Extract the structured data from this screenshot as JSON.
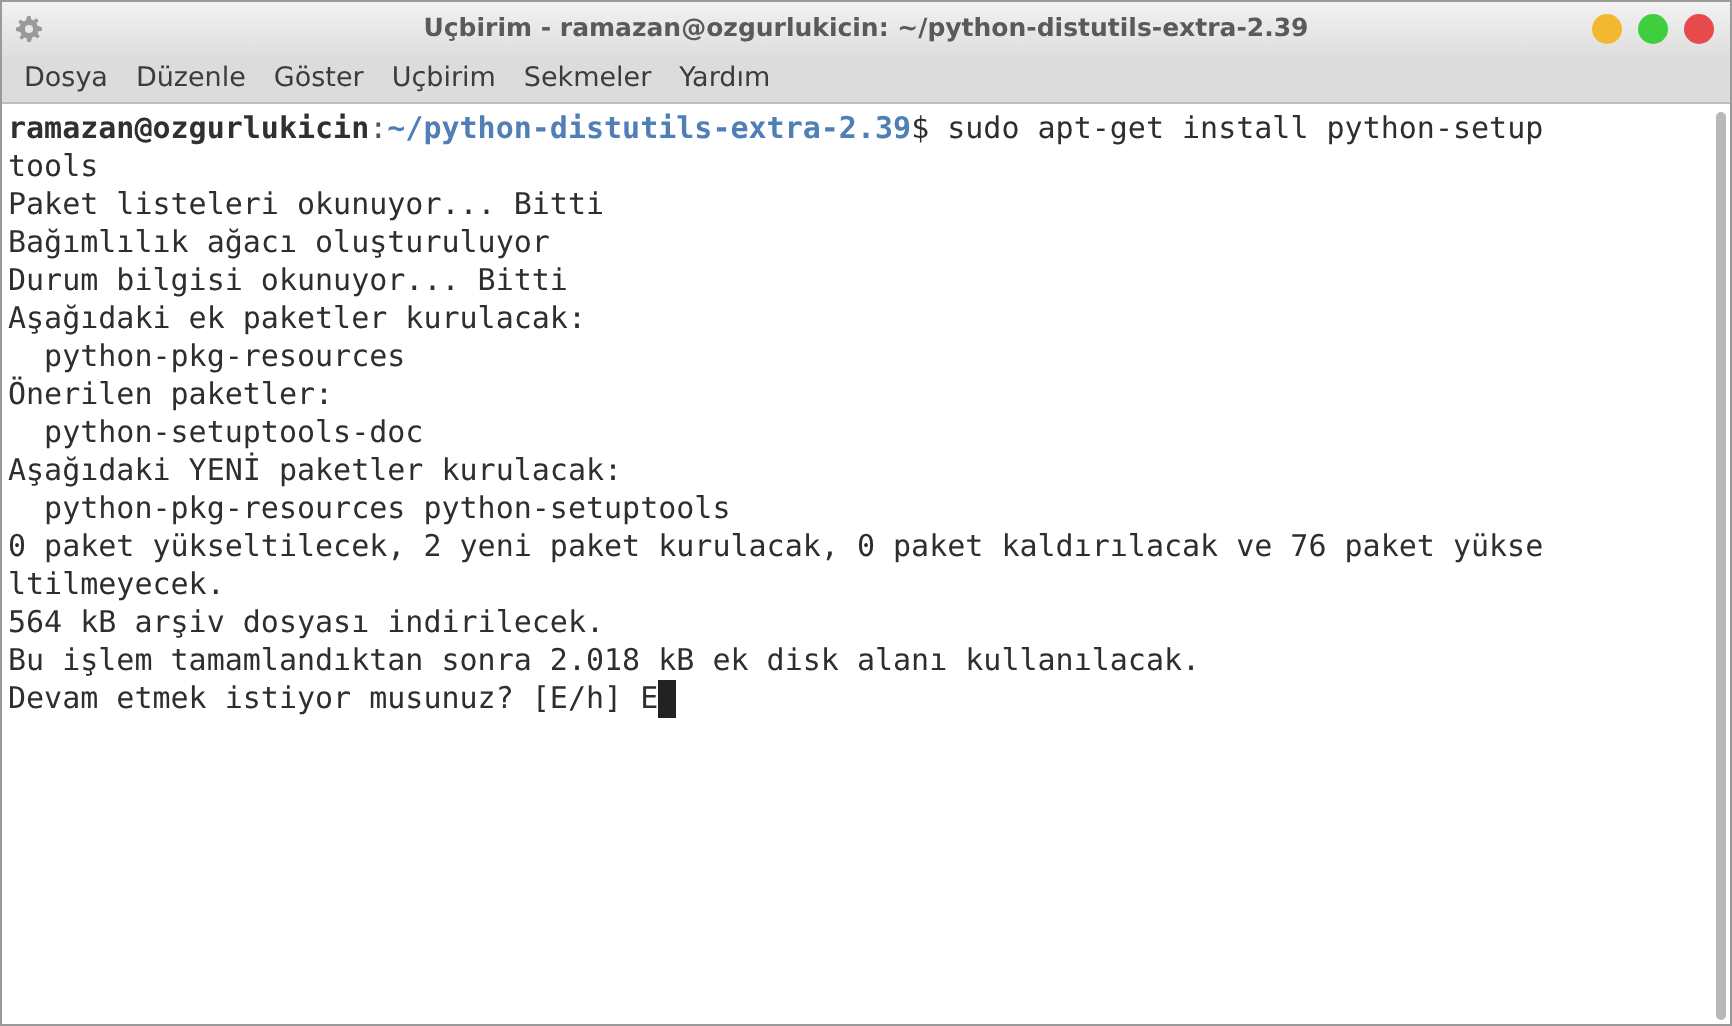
{
  "window": {
    "title": "Uçbirim - ramazan@ozgurlukicin: ~/python-distutils-extra-2.39"
  },
  "menu": [
    "Dosya",
    "Düzenle",
    "Göster",
    "Uçbirim",
    "Sekmeler",
    "Yardım"
  ],
  "terminal": {
    "prompt": {
      "user": "ramazan@ozgurlukicin",
      "separator": ":",
      "path": "~/python-distutils-extra-2.39",
      "command": "$ sudo apt-get install python-setup"
    },
    "lines": [
      "tools",
      "Paket listeleri okunuyor... Bitti",
      "Bağımlılık ağacı oluşturuluyor",
      "Durum bilgisi okunuyor... Bitti",
      "Aşağıdaki ek paketler kurulacak:",
      "  python-pkg-resources",
      "Önerilen paketler:",
      "  python-setuptools-doc",
      "Aşağıdaki YENİ paketler kurulacak:",
      "  python-pkg-resources python-setuptools",
      "0 paket yükseltilecek, 2 yeni paket kurulacak, 0 paket kaldırılacak ve 76 paket yükse",
      "ltilmeyecek.",
      "564 kB arşiv dosyası indirilecek.",
      "Bu işlem tamamlandıktan sonra 2.018 kB ek disk alanı kullanılacak.",
      "Devam etmek istiyor musunuz? [E/h] E"
    ]
  }
}
